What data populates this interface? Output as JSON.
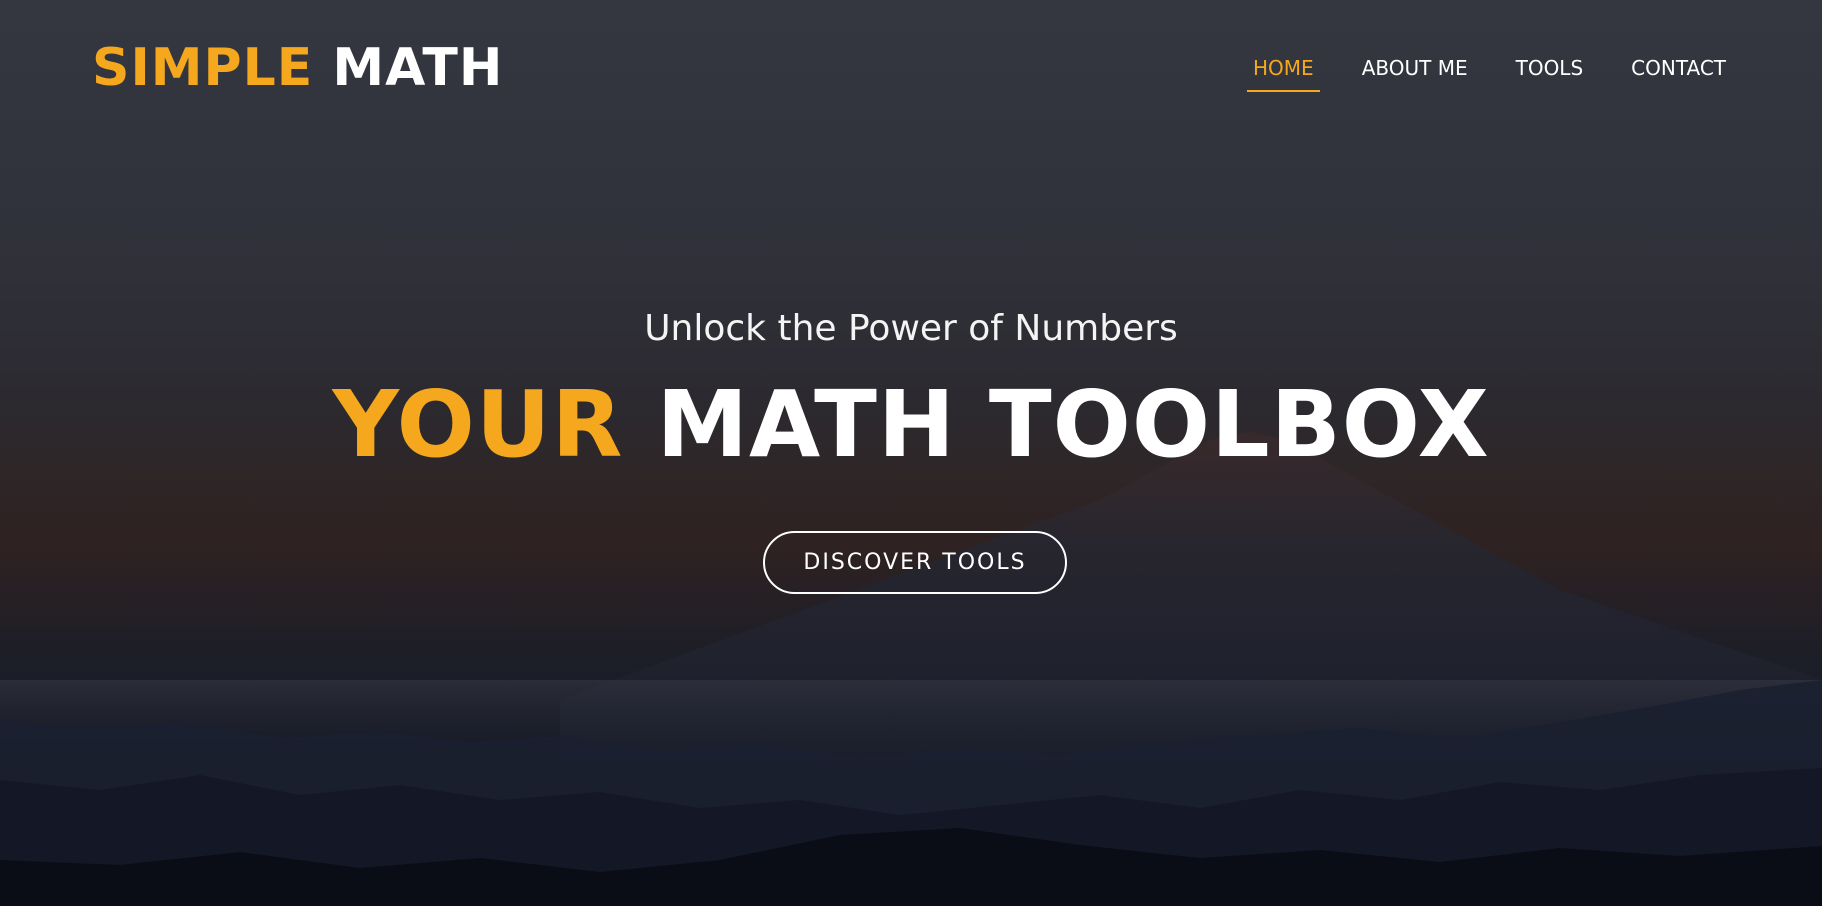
{
  "logo": {
    "accent_text": "SIMPLE",
    "plain_text": "MATH"
  },
  "nav": {
    "items": [
      {
        "label": "HOME",
        "active": true
      },
      {
        "label": "ABOUT ME",
        "active": false
      },
      {
        "label": "TOOLS",
        "active": false
      },
      {
        "label": "CONTACT",
        "active": false
      }
    ]
  },
  "hero": {
    "subtitle": "Unlock the Power of Numbers",
    "headline_accent": "YOUR",
    "headline_plain": "MATH TOOLBOX",
    "cta_label": "DISCOVER TOOLS"
  },
  "colors": {
    "accent": "#f5a81d",
    "text": "#ffffff",
    "background_top": "#343740",
    "background_bottom": "#0c0f19"
  }
}
